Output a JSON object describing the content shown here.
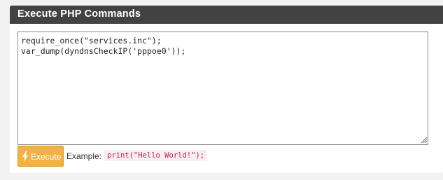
{
  "panel": {
    "title": "Execute PHP Commands"
  },
  "editor": {
    "value": "require_once(\"services.inc\");\nvar_dump(dyndnsCheckIP('pppoe0'));"
  },
  "actions": {
    "execute_label": "Execute",
    "example_label": "Example:",
    "example_code": "print(\"Hello World!\");"
  },
  "colors": {
    "heading_bg": "#424242",
    "button_bg": "#f4b244",
    "code_text": "#c7254e",
    "code_bg": "#f7eef0"
  },
  "icons": {
    "execute": "bolt-icon",
    "resize": "resize-grip-icon"
  }
}
